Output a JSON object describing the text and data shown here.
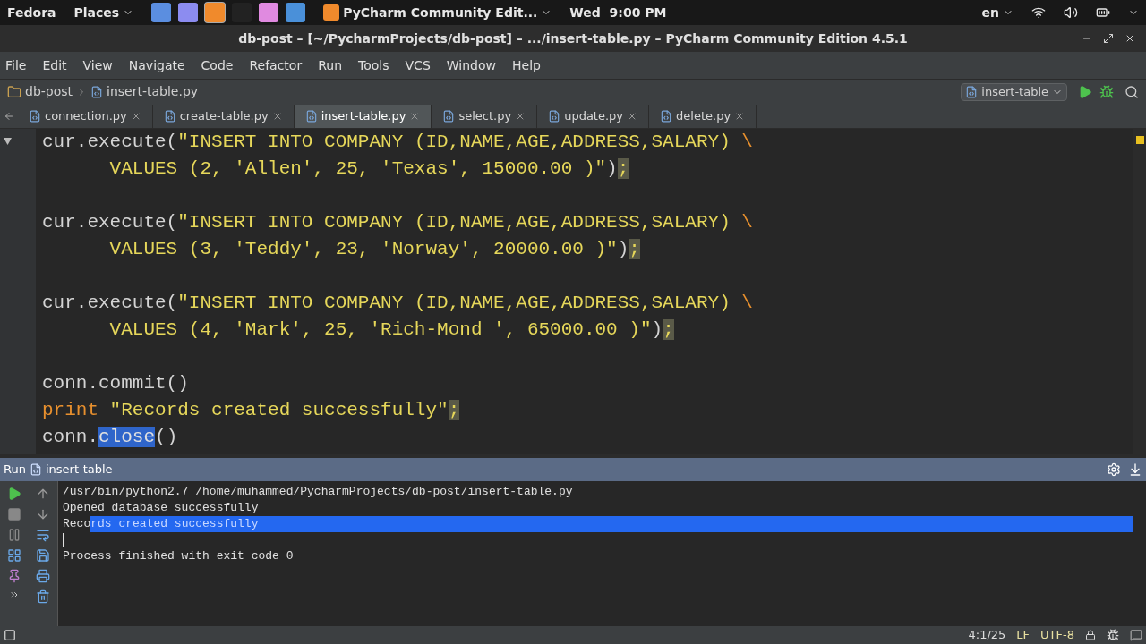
{
  "top_bar": {
    "menus": [
      "Fedora",
      "Places"
    ],
    "launchers": [
      {
        "color": "#5b8ee0",
        "selected": false
      },
      {
        "color": "#8c8cf0",
        "selected": false
      },
      {
        "color": "#f08a2c",
        "selected": true
      },
      {
        "color": "#222222",
        "selected": false
      },
      {
        "color": "#e08ae0",
        "selected": false
      },
      {
        "color": "#4a90d9",
        "selected": false
      }
    ],
    "app": "PyCharm Community Edit...",
    "clock": "Wed  9:00 PM",
    "language": "en"
  },
  "window": {
    "title": "db-post – [~/PycharmProjects/db-post] – .../insert-table.py – PyCharm Community Edition 4.5.1"
  },
  "menu": [
    "File",
    "Edit",
    "View",
    "Navigate",
    "Code",
    "Refactor",
    "Run",
    "Tools",
    "VCS",
    "Window",
    "Help"
  ],
  "breadcrumb": [
    "db-post",
    "insert-table.py"
  ],
  "run_config": "insert-table",
  "tabs": [
    {
      "label": "connection.py",
      "selected": false
    },
    {
      "label": "create-table.py",
      "selected": false
    },
    {
      "label": "insert-table.py",
      "selected": true
    },
    {
      "label": "select.py",
      "selected": false
    },
    {
      "label": "update.py",
      "selected": false
    },
    {
      "label": "delete.py",
      "selected": false
    }
  ],
  "editor": {
    "lines": [
      {
        "kind": "code",
        "tokens": [
          {
            "t": "cur.execute(",
            "kind": "plain"
          },
          {
            "t": "\"INSERT INTO COMPANY (ID,NAME,AGE,ADDRESS,SALARY) ",
            "kind": "string"
          },
          {
            "t": "\\",
            "kind": "keyword"
          }
        ]
      },
      {
        "kind": "code",
        "tokens": [
          {
            "t": "      VALUES (2, 'Allen', 25, 'Texas', 15000.00 )\"",
            "kind": "string"
          },
          {
            "t": ")",
            "kind": "plain"
          },
          {
            "t": ";",
            "kind": "warn"
          }
        ]
      },
      {
        "kind": "blank"
      },
      {
        "kind": "code",
        "tokens": [
          {
            "t": "cur.execute(",
            "kind": "plain"
          },
          {
            "t": "\"INSERT INTO COMPANY (ID,NAME,AGE,ADDRESS,SALARY) ",
            "kind": "string"
          },
          {
            "t": "\\",
            "kind": "keyword"
          }
        ]
      },
      {
        "kind": "code",
        "tokens": [
          {
            "t": "      VALUES (3, 'Teddy', 23, 'Norway', 20000.00 )\"",
            "kind": "string"
          },
          {
            "t": ")",
            "kind": "plain"
          },
          {
            "t": ";",
            "kind": "warn"
          }
        ]
      },
      {
        "kind": "blank"
      },
      {
        "kind": "code",
        "tokens": [
          {
            "t": "cur.execute(",
            "kind": "plain"
          },
          {
            "t": "\"INSERT INTO COMPANY (ID,NAME,AGE,ADDRESS,SALARY) ",
            "kind": "string"
          },
          {
            "t": "\\",
            "kind": "keyword"
          }
        ]
      },
      {
        "kind": "code",
        "tokens": [
          {
            "t": "      VALUES (4, 'Mark', 25, 'Rich-Mond ', 65000.00 )\"",
            "kind": "string"
          },
          {
            "t": ")",
            "kind": "plain"
          },
          {
            "t": ";",
            "kind": "warn"
          }
        ]
      },
      {
        "kind": "blank"
      },
      {
        "kind": "code",
        "tokens": [
          {
            "t": "conn.commit()",
            "kind": "plain"
          }
        ]
      },
      {
        "kind": "code",
        "tokens": [
          {
            "t": "print",
            "kind": "keyword"
          },
          {
            "t": " \"Records created successfully\"",
            "kind": "string"
          },
          {
            "t": ";",
            "kind": "warn"
          }
        ]
      },
      {
        "kind": "code",
        "tokens": [
          {
            "t": "conn.",
            "kind": "plain"
          },
          {
            "t": "close",
            "kind": "selected"
          },
          {
            "t": "()",
            "kind": "plain"
          }
        ]
      }
    ]
  },
  "run_panel": {
    "label": "Run",
    "config": "insert-table",
    "console": [
      {
        "kind": "text",
        "segments": [
          {
            "t": "/usr/bin/python2.7 /home/muhammed/PycharmProjects/db-post/insert-table.py",
            "selected": false
          }
        ]
      },
      {
        "kind": "text",
        "segments": [
          {
            "t": "Opened database successfully",
            "selected": false
          }
        ]
      },
      {
        "kind": "text",
        "segments": [
          {
            "t": "Reco",
            "selected": false
          },
          {
            "t": "rds created successfully",
            "selected": true
          }
        ]
      },
      {
        "kind": "cursor"
      },
      {
        "kind": "text",
        "segments": [
          {
            "t": "Process finished with exit code 0",
            "selected": false
          }
        ]
      }
    ]
  },
  "status_bar": {
    "position": "4:1/25",
    "line_sep": "LF",
    "encoding": "UTF-8"
  }
}
